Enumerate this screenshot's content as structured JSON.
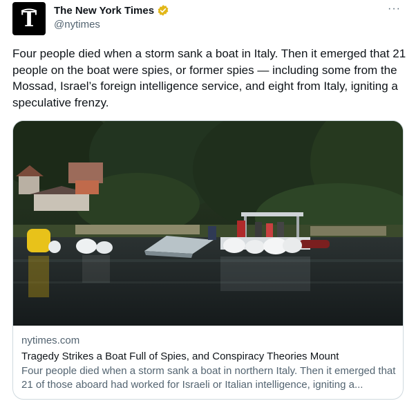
{
  "account": {
    "display_name": "The New York Times",
    "handle": "@nytimes",
    "verified_badge": "gold-verified-check-icon",
    "avatar": "nyt-t-logo"
  },
  "menu": {
    "more_label": "···"
  },
  "tweet": {
    "text": "Four people died when a storm sank a boat in Italy. Then it emerged that 21 people on the boat were spies, or former spies — including some from the Mossad, Israel’s foreign intelligence service, and eight from Italy, igniting a speculative frenzy."
  },
  "card": {
    "domain": "nytimes.com",
    "title": "Tragedy Strikes a Boat Full of Spies, and Conspiracy Theories Mount",
    "description": "Four people died when a storm sank a boat in northern Italy. Then it emerged that 21 of those aboard had worked for Israeli or Italian intelligence, igniting a..."
  },
  "colors": {
    "text_primary": "#0f1419",
    "text_secondary": "#536471",
    "border": "#cfd9de",
    "verified_gold": "#e2b719"
  }
}
